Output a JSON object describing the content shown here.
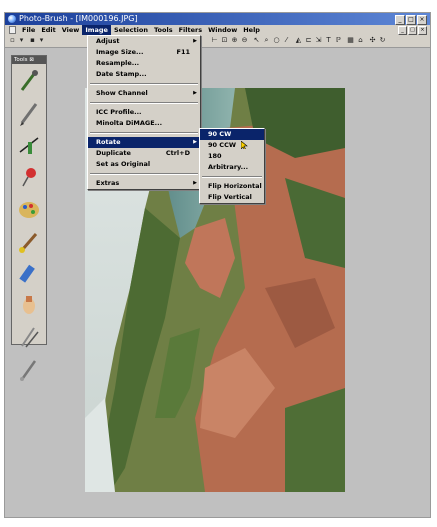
{
  "window": {
    "title": "Photo-Brush - [IM000196.JPG]",
    "controls": [
      "_",
      "□",
      "×"
    ],
    "mdi_controls": [
      "_",
      "□",
      "×"
    ]
  },
  "menubar": {
    "items": [
      "File",
      "Edit",
      "View",
      "Image",
      "Selection",
      "Tools",
      "Filters",
      "Window",
      "Help"
    ],
    "active": "Image"
  },
  "tools_palette": {
    "title": "Tools",
    "close": "⊠",
    "tools": [
      "eyedropper-icon",
      "pencil-icon",
      "line-tool-icon",
      "pushpin-icon",
      "palette-icon",
      "brush-icon",
      "eraser-icon",
      "hand-icon",
      "clone-brush-icon",
      "smudge-brush-icon"
    ]
  },
  "image_menu": {
    "items": [
      {
        "label": "Adjust",
        "submenu": true
      },
      {
        "label": "Image Size...",
        "shortcut": "F11"
      },
      {
        "label": "Resample..."
      },
      {
        "label": "Date Stamp..."
      },
      {
        "separator": true
      },
      {
        "label": "Show Channel",
        "submenu": true
      },
      {
        "separator": true
      },
      {
        "label": "ICC Profile..."
      },
      {
        "label": "Minolta DiMAGE..."
      },
      {
        "separator": true
      },
      {
        "label": "Rotate",
        "submenu": true,
        "highlighted": true
      },
      {
        "label": "Duplicate",
        "shortcut": "Ctrl+D"
      },
      {
        "label": "Set as Original"
      },
      {
        "separator": true
      },
      {
        "label": "Extras",
        "submenu": true
      }
    ]
  },
  "rotate_submenu": {
    "items": [
      {
        "label": "90 CW",
        "highlighted": true
      },
      {
        "label": "90 CCW"
      },
      {
        "label": "180"
      },
      {
        "label": "Arbitrary..."
      },
      {
        "separator": true
      },
      {
        "label": "Flip Horizontal"
      },
      {
        "label": "Flip Vertical"
      }
    ]
  },
  "colors": {
    "title_bar": "#1b3f9a",
    "highlight": "#0a246a",
    "chrome": "#d4d0c8",
    "workspace": "#c0c0c0"
  }
}
